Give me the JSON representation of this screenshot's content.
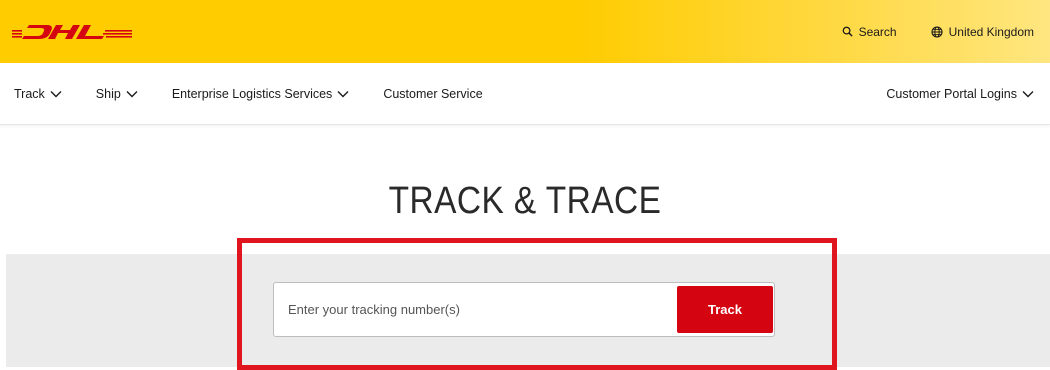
{
  "brand": {
    "logo_text": "DHL",
    "primary_color": "#ffcc00",
    "accent_color": "#d40511"
  },
  "header": {
    "search": {
      "label": "Search",
      "icon": "search-icon"
    },
    "country": {
      "label": "United Kingdom",
      "icon": "globe-icon"
    }
  },
  "nav": {
    "items": [
      {
        "label": "Track",
        "has_dropdown": true
      },
      {
        "label": "Ship",
        "has_dropdown": true
      },
      {
        "label": "Enterprise Logistics Services",
        "has_dropdown": true
      },
      {
        "label": "Customer Service",
        "has_dropdown": false
      }
    ],
    "right": {
      "label": "Customer Portal Logins",
      "has_dropdown": true
    }
  },
  "main": {
    "title": "TRACK & TRACE",
    "tracking": {
      "placeholder": "Enter your tracking number(s)",
      "value": "",
      "button_label": "Track"
    },
    "highlight_color": "#e0161f"
  }
}
